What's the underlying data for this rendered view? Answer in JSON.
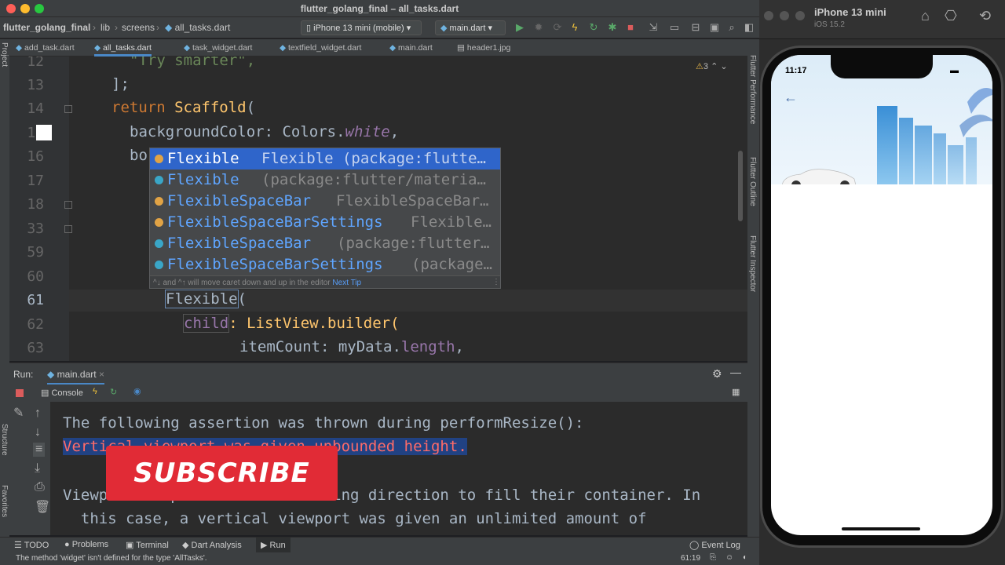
{
  "window": {
    "title": "flutter_golang_final – all_tasks.dart"
  },
  "breadcrumbs": [
    "flutter_golang_final",
    "lib",
    "screens",
    "all_tasks.dart"
  ],
  "toolbar": {
    "device": "iPhone 13 mini (mobile)",
    "run_config": "main.dart"
  },
  "tabs": [
    "add_task.dart",
    "all_tasks.dart",
    "task_widget.dart",
    "textfield_widget.dart",
    "main.dart",
    "header1.jpg"
  ],
  "editor": {
    "line_numbers": [
      "12",
      "13",
      "14",
      "15",
      "16",
      "17",
      "18",
      "33",
      "59",
      "60",
      "61",
      "62",
      "63"
    ],
    "warnings": "3",
    "line12": "\"Try smarter\",",
    "line13": "];",
    "line14_kw": "return",
    "line14_fn": "Scaffold",
    "line14_end": "(",
    "line15_a": "backgroundColor: Colors.",
    "line15_b": "white",
    "line15_c": ",",
    "line16": "bo",
    "line61_a": "Flexible",
    "line61_b": "(",
    "line62_a": "child",
    "line62_b": ": ListView.builder(",
    "line63_a": "itemCount: myData.",
    "line63_b": "length",
    "line63_c": ","
  },
  "completion": {
    "items": [
      {
        "name": "Flexible",
        "detail": "Flexible (package:flutte…"
      },
      {
        "name": "Flexible",
        "detail": "(package:flutter/materia…"
      },
      {
        "name": "FlexibleSpaceBar",
        "detail": "FlexibleSpaceBar…"
      },
      {
        "name": "FlexibleSpaceBarSettings",
        "detail": "Flexible…"
      },
      {
        "name": "FlexibleSpaceBar",
        "detail": "(package:flutter…"
      },
      {
        "name": "FlexibleSpaceBarSettings",
        "detail": "(package…"
      }
    ],
    "footer": "^↓ and ^↑ will move caret down and up in the editor",
    "next_tip": "Next Tip"
  },
  "run_panel": {
    "label": "Run:",
    "config": "main.dart",
    "console_tab": "Console",
    "lines": [
      "The following assertion was thrown during performResize():",
      "Vertical viewport was given unbounded height.",
      "",
      "Viewports expand in the scrolling direction to fill their container. In",
      "  this case, a vertical viewport was given an unlimited amount of"
    ]
  },
  "overlay": {
    "subscribe": "SUBSCRIBE"
  },
  "bottom_tabs": [
    "TODO",
    "Problems",
    "Terminal",
    "Dart Analysis",
    "Run"
  ],
  "event_log": "Event Log",
  "status": {
    "message": "The method 'widget' isn't defined for the type 'AllTasks'.",
    "position": "61:19"
  },
  "side_tools": {
    "right": [
      "Flutter Performance",
      "Flutter Outline",
      "Flutter Inspector"
    ],
    "left": [
      "Project",
      "Structure",
      "Favorites"
    ]
  },
  "simulator": {
    "device": "iPhone 13 mini",
    "os": "iOS 15.2",
    "time": "11:17"
  },
  "colors": {
    "accent": "#2f65ca",
    "error": "#ff6b68",
    "subscribe": "#e12b36"
  }
}
